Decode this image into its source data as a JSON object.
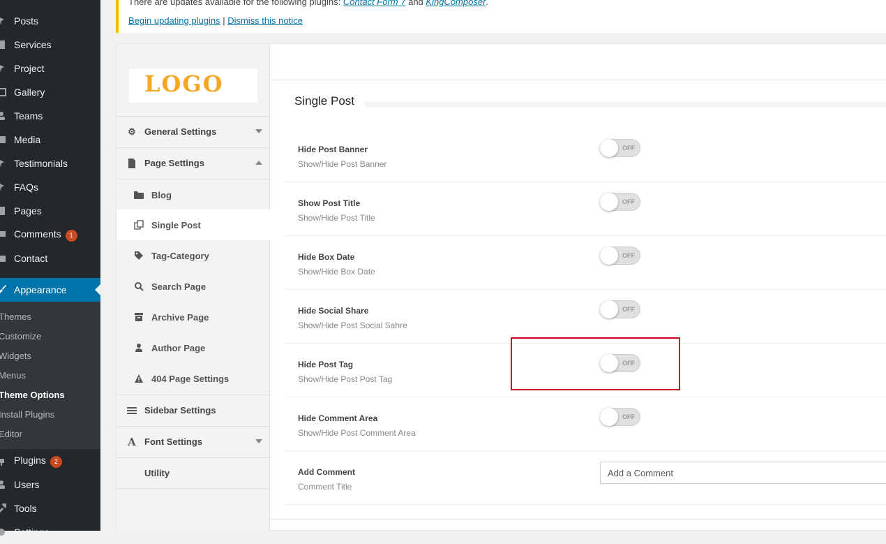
{
  "wp_menu": {
    "items": [
      {
        "label": "Posts",
        "icon": "pin-icon"
      },
      {
        "label": "Services",
        "icon": "pages-icon"
      },
      {
        "label": "Project",
        "icon": "pin-icon"
      },
      {
        "label": "Gallery",
        "icon": "gallery-icon"
      },
      {
        "label": "Teams",
        "icon": "users-icon"
      },
      {
        "label": "Media",
        "icon": "media-icon"
      },
      {
        "label": "Testimonials",
        "icon": "pin-icon"
      },
      {
        "label": "FAQs",
        "icon": "pin-icon"
      },
      {
        "label": "Pages",
        "icon": "page-icon"
      },
      {
        "label": "Comments",
        "icon": "comment-icon",
        "badge": "1"
      },
      {
        "label": "Contact",
        "icon": "mail-icon"
      }
    ],
    "appearance": {
      "label": "Appearance",
      "icon": "brush-icon"
    },
    "appearance_sub": [
      "Themes",
      "Customize",
      "Widgets",
      "Menus",
      "Theme Options",
      "Install Plugins",
      "Editor"
    ],
    "appearance_sub_current": "Theme Options",
    "lower_items": [
      {
        "label": "Plugins",
        "icon": "plugin-icon",
        "badge": "2"
      },
      {
        "label": "Users",
        "icon": "user-icon"
      },
      {
        "label": "Tools",
        "icon": "wrench-icon"
      },
      {
        "label": "Settings",
        "icon": "settings-icon"
      }
    ]
  },
  "notice": {
    "text_prefix": "There are updates available for the following plugins:",
    "plugin1": "Contact Form 7",
    "and": "and",
    "plugin2": "KingComposer",
    "period": ".",
    "begin_link": "Begin updating plugins",
    "separator": "|",
    "dismiss_link": "Dismiss this notice",
    "accent_color": "#ffb900"
  },
  "logo": {
    "text": "LOGO",
    "color": "#f5a623"
  },
  "options_nav": {
    "general": "General Settings",
    "page": "Page Settings",
    "sub": [
      {
        "label": "Blog",
        "icon": "folder-icon"
      },
      {
        "label": "Single Post",
        "icon": "copy-icon"
      },
      {
        "label": "Tag-Category",
        "icon": "tags-icon"
      },
      {
        "label": "Search Page",
        "icon": "search-icon"
      },
      {
        "label": "Archive Page",
        "icon": "archive-icon"
      },
      {
        "label": "Author Page",
        "icon": "user-icon"
      },
      {
        "label": "404 Page Settings",
        "icon": "warning-icon"
      }
    ],
    "active": "Single Post",
    "sidebar": "Sidebar Settings",
    "font": "Font Settings",
    "utility": "Utility"
  },
  "section": {
    "title": "Single Post",
    "rows": [
      {
        "name": "Hide Post Banner",
        "desc": "Show/Hide Post Banner",
        "state": "OFF"
      },
      {
        "name": "Show Post Title",
        "desc": "Show/Hide Post Title",
        "state": "OFF"
      },
      {
        "name": "Hide Box Date",
        "desc": "Show/Hide Box Date",
        "state": "OFF"
      },
      {
        "name": "Hide Social Share",
        "desc": "Show/Hide Post Social Sahre",
        "state": "OFF"
      },
      {
        "name": "Hide Post Tag",
        "desc": "Show/Hide Post Post Tag",
        "state": "OFF"
      },
      {
        "name": "Hide Comment Area",
        "desc": "Show/Hide Post Comment Area",
        "state": "OFF"
      }
    ],
    "comment_row": {
      "name": "Add Comment",
      "desc": "Comment Title",
      "placeholder": "Add a Comment"
    }
  },
  "colors": {
    "sidebar": "#23282d",
    "active": "#0073aa",
    "highlight": "#d0021b"
  }
}
